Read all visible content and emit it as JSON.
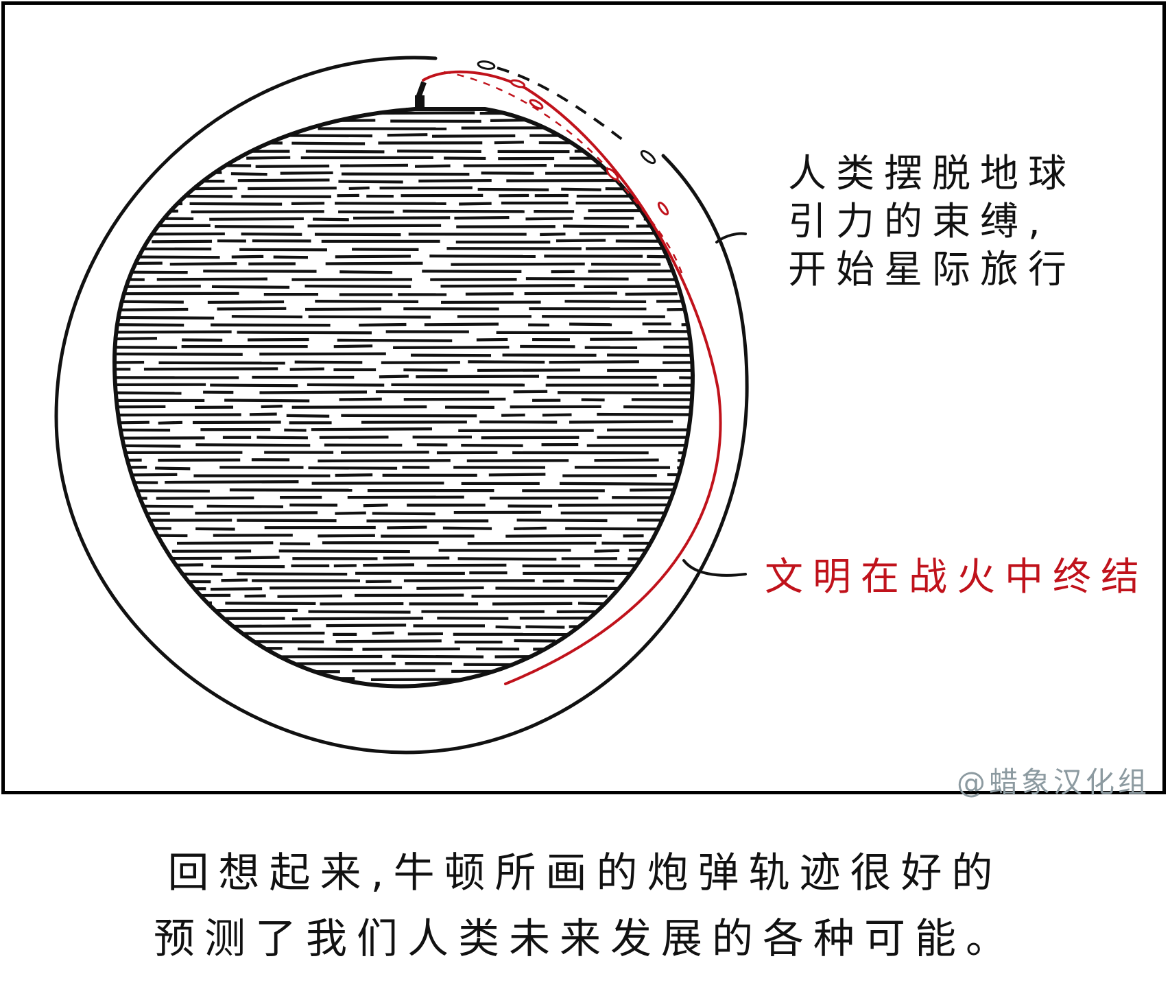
{
  "panel": {
    "escape_label_lines": [
      "人类摆脱地球",
      "引力的束缚,",
      "开始星际旅行"
    ],
    "end_label": "文明在战火中终结",
    "watermark": "@蜡象汉化组"
  },
  "caption": {
    "lines": [
      "回想起来,牛顿所画的炮弹轨迹很好的",
      "预测了我们人类未来发展的各种可能。"
    ]
  },
  "colors": {
    "ink": "#111111",
    "accent_red": "#c0121b",
    "watermark": "#8c9aa0",
    "background": "#ffffff"
  }
}
